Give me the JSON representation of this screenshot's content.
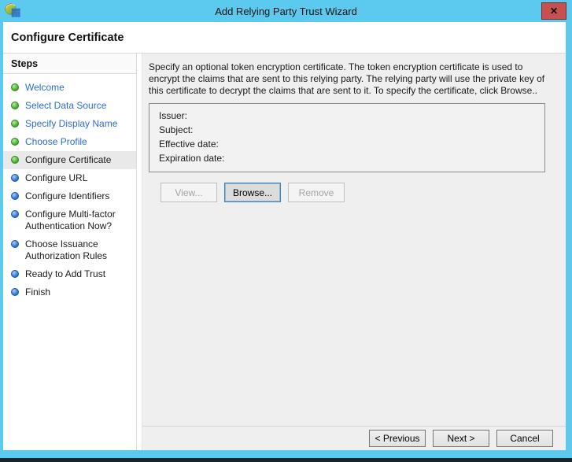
{
  "window": {
    "title": "Add Relying Party Trust Wizard",
    "close_glyph": "✕"
  },
  "header": {
    "title": "Configure Certificate"
  },
  "sidebar": {
    "title": "Steps",
    "items": [
      {
        "label": "Welcome",
        "state": "completed"
      },
      {
        "label": "Select Data Source",
        "state": "completed"
      },
      {
        "label": "Specify Display Name",
        "state": "completed"
      },
      {
        "label": "Choose Profile",
        "state": "completed"
      },
      {
        "label": "Configure Certificate",
        "state": "current"
      },
      {
        "label": "Configure URL",
        "state": "upcoming"
      },
      {
        "label": "Configure Identifiers",
        "state": "upcoming"
      },
      {
        "label": "Configure Multi-factor Authentication Now?",
        "state": "upcoming"
      },
      {
        "label": "Choose Issuance Authorization Rules",
        "state": "upcoming"
      },
      {
        "label": "Ready to Add Trust",
        "state": "upcoming"
      },
      {
        "label": "Finish",
        "state": "upcoming"
      }
    ]
  },
  "content": {
    "instruction": "Specify an optional token encryption certificate.  The token encryption certificate is used to encrypt the claims that are sent to this relying party.  The relying party will use the private key of this certificate to decrypt the claims that are sent to it.  To specify the certificate, click Browse..",
    "certificate_box": {
      "fields": [
        "Issuer:",
        "Subject:",
        "Effective date:",
        "Expiration date:"
      ]
    },
    "buttons": {
      "view": "View...",
      "browse": "Browse...",
      "remove": "Remove"
    }
  },
  "footer": {
    "previous": "< Previous",
    "next": "Next >",
    "cancel": "Cancel"
  },
  "colors": {
    "titlebar": "#5CC9EE",
    "close_button": "#C75050",
    "step_done": "#45B02F",
    "step_pending": "#2E74D4",
    "link_blue": "#2E6BD4"
  }
}
